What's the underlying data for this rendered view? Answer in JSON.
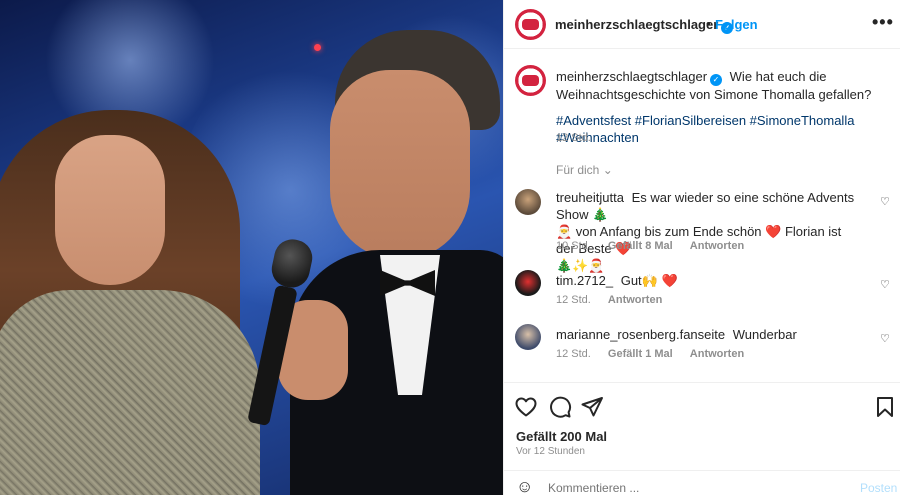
{
  "post": {
    "username": "meinherzschlaegtschlager",
    "follow_label": "Folgen",
    "more_label": "•••"
  },
  "caption": {
    "username": "meinherzschlaegtschlager",
    "text": "Wie hat euch die Weihnachtsgeschichte von Simone Thomalla gefallen?",
    "hashtags": "#Adventsfest #FlorianSilbereisen #SimoneThomalla #Weihnachten",
    "time": "12 Std.",
    "for_you": "Für dich"
  },
  "comments": [
    {
      "username": "treuheitjutta",
      "text_part1": "Es war wieder so eine schöne Advents Show 🎄",
      "text_part2": "🎅 von Anfang bis zum Ende schön ❤️ Florian ist der Beste ❤️",
      "text_part3": "🎄✨🎅",
      "time": "10 Std.",
      "likes": "Gefällt 8 Mal",
      "reply": "Antworten"
    },
    {
      "username": "tim.2712_",
      "text": "Gut🙌 ❤️",
      "time": "12 Std.",
      "reply": "Antworten"
    },
    {
      "username": "marianne_rosenberg.fanseite",
      "text": "Wunderbar",
      "time": "12 Std.",
      "likes": "Gefällt 1 Mal",
      "reply": "Antworten"
    }
  ],
  "footer": {
    "likes": "Gefällt 200 Mal",
    "time_ago": "Vor 12 Stunden",
    "comment_placeholder": "Kommentieren ...",
    "post_label": "Posten"
  },
  "colors": {
    "link_blue": "#0095f6",
    "hashtag_blue": "#00376b",
    "heart_red": "#ed4956",
    "muted_gray": "#8e8e8e"
  }
}
